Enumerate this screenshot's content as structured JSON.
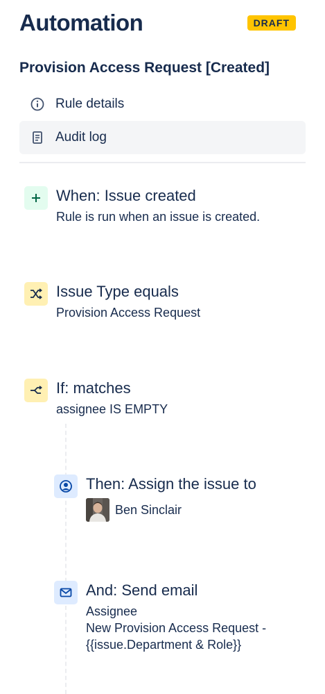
{
  "header": {
    "title": "Automation",
    "badge": "DRAFT"
  },
  "rule": {
    "title": "Provision Access Request [Created]"
  },
  "menu": {
    "items": [
      {
        "label": "Rule details",
        "icon": "info-icon"
      },
      {
        "label": "Audit log",
        "icon": "document-icon",
        "selected": true
      }
    ]
  },
  "steps": [
    {
      "title": "When: Issue created",
      "subtitle": "Rule is run when an issue is created.",
      "icon": "plus-icon",
      "color": "#E3FCEF"
    },
    {
      "title": "Issue Type equals",
      "subtitle": "Provision Access Request",
      "icon": "shuffle-icon",
      "color": "#FFF0B3"
    },
    {
      "title": "If: matches",
      "subtitle": "assignee IS EMPTY",
      "icon": "branch-icon",
      "color": "#FFF0B3"
    },
    {
      "title": "Then: Assign the issue to",
      "assignee": "Ben Sinclair",
      "icon": "user-circle-icon",
      "color": "#DEEBFF"
    },
    {
      "title": "And: Send email",
      "lines": [
        "Assignee",
        "New Provision Access Request -",
        "{{issue.Department & Role}}"
      ],
      "icon": "mail-icon",
      "color": "#DEEBFF"
    }
  ]
}
